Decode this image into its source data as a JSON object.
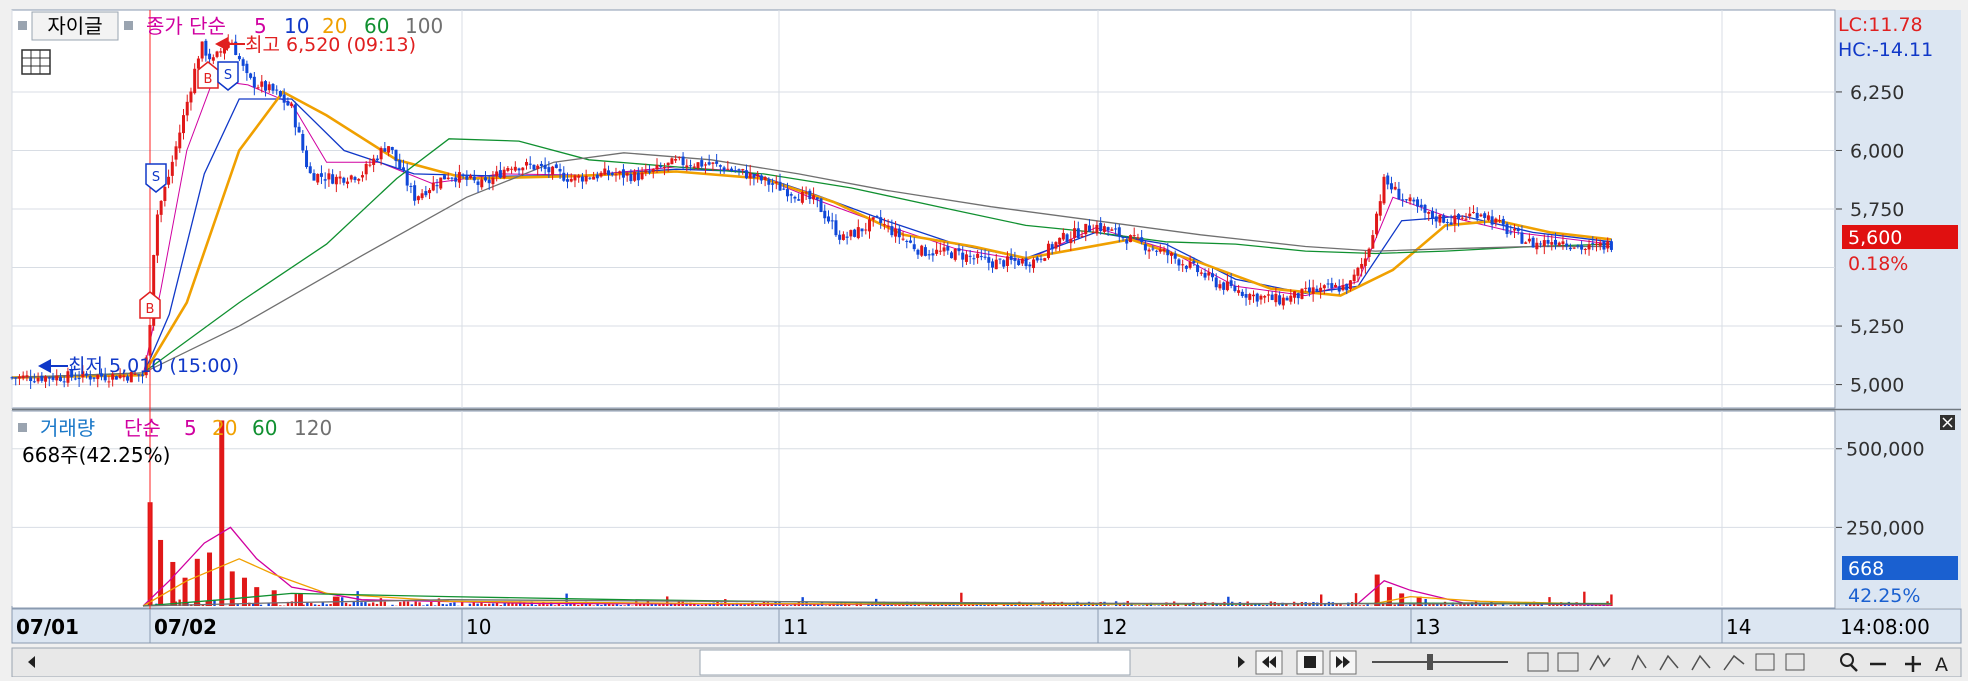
{
  "app": {
    "toolbar_button": "자이글",
    "icon_names": [
      "grid-icon",
      "close-icon",
      "rewind-icon",
      "stop-icon",
      "fast-forward-icon",
      "search-icon",
      "minus-icon",
      "plus-icon"
    ],
    "zoom_text_button": "A"
  },
  "price_panel": {
    "legend": {
      "label": "종가 단순",
      "periods": [
        "5",
        "10",
        "20",
        "60",
        "100"
      ],
      "colors": [
        "#d000a0",
        "#1038c8",
        "#f0a000",
        "#109030",
        "#707070"
      ]
    },
    "high_label": "최고 6,520 (09:13)",
    "low_label": "최저 5,010 (15:00)",
    "lc_label": "LC:11.78",
    "hc_label": "HC:-14.11",
    "current_price": "5,600",
    "change_pct": "0.18%",
    "axis_ticks": [
      "6,250",
      "6,000",
      "5,750",
      "5,250",
      "5,000"
    ],
    "signals": [
      "B",
      "S",
      "B",
      "S"
    ]
  },
  "volume_panel": {
    "legend": {
      "label": "거래량",
      "ma_label": "단순",
      "periods": [
        "5",
        "20",
        "60",
        "120"
      ],
      "colors": [
        "#d000a0",
        "#f0a000",
        "#109030",
        "#707070"
      ]
    },
    "info": "668주(42.25%)",
    "current_volume": "668",
    "current_pct": "42.25%",
    "axis_ticks": [
      "500,000",
      "250,000"
    ]
  },
  "x_axis": {
    "labels": [
      "07/01",
      "07/02",
      "10",
      "11",
      "12",
      "13",
      "14"
    ],
    "time": "14:08:00"
  },
  "chart_data": {
    "type": "candlestick",
    "price_range": [
      4900,
      6600
    ],
    "volume_range": [
      0,
      620000
    ],
    "session_dates": [
      "07/01",
      "07/02",
      "10",
      "11",
      "12",
      "13",
      "14"
    ],
    "price_path": [
      [
        0.0,
        5030
      ],
      [
        0.075,
        5040
      ],
      [
        0.078,
        5150
      ],
      [
        0.082,
        5700
      ],
      [
        0.09,
        5900
      ],
      [
        0.1,
        6200
      ],
      [
        0.108,
        6450
      ],
      [
        0.115,
        6380
      ],
      [
        0.125,
        6480
      ],
      [
        0.135,
        6300
      ],
      [
        0.15,
        6250
      ],
      [
        0.16,
        6180
      ],
      [
        0.17,
        5900
      ],
      [
        0.185,
        5880
      ],
      [
        0.2,
        5900
      ],
      [
        0.215,
        6030
      ],
      [
        0.23,
        5800
      ],
      [
        0.25,
        5900
      ],
      [
        0.27,
        5850
      ],
      [
        0.285,
        5940
      ],
      [
        0.3,
        5930
      ],
      [
        0.32,
        5880
      ],
      [
        0.34,
        5900
      ],
      [
        0.36,
        5890
      ],
      [
        0.38,
        5950
      ],
      [
        0.4,
        5940
      ],
      [
        0.42,
        5900
      ],
      [
        0.44,
        5840
      ],
      [
        0.46,
        5780
      ],
      [
        0.475,
        5620
      ],
      [
        0.495,
        5700
      ],
      [
        0.52,
        5570
      ],
      [
        0.54,
        5560
      ],
      [
        0.56,
        5520
      ],
      [
        0.585,
        5530
      ],
      [
        0.6,
        5620
      ],
      [
        0.62,
        5680
      ],
      [
        0.64,
        5620
      ],
      [
        0.66,
        5560
      ],
      [
        0.675,
        5500
      ],
      [
        0.69,
        5430
      ],
      [
        0.71,
        5380
      ],
      [
        0.725,
        5360
      ],
      [
        0.745,
        5400
      ],
      [
        0.765,
        5420
      ],
      [
        0.775,
        5550
      ],
      [
        0.785,
        5870
      ],
      [
        0.795,
        5800
      ],
      [
        0.81,
        5720
      ],
      [
        0.825,
        5700
      ],
      [
        0.84,
        5740
      ],
      [
        0.855,
        5660
      ],
      [
        0.87,
        5600
      ],
      [
        0.885,
        5620
      ],
      [
        0.9,
        5580
      ],
      [
        0.915,
        5600
      ]
    ],
    "ma_series": [
      {
        "name": "5",
        "values": [
          [
            0.0,
            5030
          ],
          [
            0.075,
            5040
          ],
          [
            0.085,
            5400
          ],
          [
            0.1,
            6000
          ],
          [
            0.115,
            6300
          ],
          [
            0.135,
            6280
          ],
          [
            0.16,
            6200
          ],
          [
            0.18,
            5950
          ],
          [
            0.21,
            5950
          ],
          [
            0.24,
            5860
          ],
          [
            0.28,
            5900
          ],
          [
            0.33,
            5895
          ],
          [
            0.38,
            5930
          ],
          [
            0.42,
            5910
          ],
          [
            0.46,
            5790
          ],
          [
            0.5,
            5680
          ],
          [
            0.54,
            5580
          ],
          [
            0.58,
            5530
          ],
          [
            0.62,
            5670
          ],
          [
            0.66,
            5580
          ],
          [
            0.7,
            5420
          ],
          [
            0.74,
            5380
          ],
          [
            0.77,
            5440
          ],
          [
            0.79,
            5800
          ],
          [
            0.82,
            5720
          ],
          [
            0.86,
            5650
          ],
          [
            0.915,
            5600
          ]
        ]
      },
      {
        "name": "10",
        "values": [
          [
            0.0,
            5030
          ],
          [
            0.075,
            5040
          ],
          [
            0.09,
            5300
          ],
          [
            0.11,
            5900
          ],
          [
            0.13,
            6220
          ],
          [
            0.16,
            6220
          ],
          [
            0.19,
            6000
          ],
          [
            0.23,
            5900
          ],
          [
            0.28,
            5890
          ],
          [
            0.33,
            5895
          ],
          [
            0.38,
            5920
          ],
          [
            0.42,
            5910
          ],
          [
            0.46,
            5810
          ],
          [
            0.5,
            5700
          ],
          [
            0.54,
            5600
          ],
          [
            0.58,
            5540
          ],
          [
            0.62,
            5650
          ],
          [
            0.66,
            5600
          ],
          [
            0.7,
            5450
          ],
          [
            0.74,
            5390
          ],
          [
            0.77,
            5420
          ],
          [
            0.795,
            5700
          ],
          [
            0.83,
            5720
          ],
          [
            0.87,
            5650
          ],
          [
            0.915,
            5610
          ]
        ]
      },
      {
        "name": "20",
        "values": [
          [
            0.0,
            5030
          ],
          [
            0.075,
            5040
          ],
          [
            0.1,
            5350
          ],
          [
            0.13,
            6000
          ],
          [
            0.155,
            6250
          ],
          [
            0.18,
            6150
          ],
          [
            0.22,
            5960
          ],
          [
            0.26,
            5880
          ],
          [
            0.32,
            5890
          ],
          [
            0.38,
            5910
          ],
          [
            0.43,
            5880
          ],
          [
            0.47,
            5780
          ],
          [
            0.51,
            5640
          ],
          [
            0.55,
            5590
          ],
          [
            0.58,
            5540
          ],
          [
            0.61,
            5580
          ],
          [
            0.64,
            5620
          ],
          [
            0.68,
            5520
          ],
          [
            0.72,
            5410
          ],
          [
            0.76,
            5380
          ],
          [
            0.79,
            5490
          ],
          [
            0.82,
            5680
          ],
          [
            0.85,
            5700
          ],
          [
            0.88,
            5650
          ],
          [
            0.915,
            5620
          ]
        ]
      },
      {
        "name": "60",
        "values": [
          [
            0.0,
            5030
          ],
          [
            0.075,
            5050
          ],
          [
            0.13,
            5350
          ],
          [
            0.18,
            5600
          ],
          [
            0.22,
            5880
          ],
          [
            0.25,
            6050
          ],
          [
            0.29,
            6040
          ],
          [
            0.33,
            5960
          ],
          [
            0.38,
            5930
          ],
          [
            0.43,
            5900
          ],
          [
            0.48,
            5840
          ],
          [
            0.53,
            5760
          ],
          [
            0.58,
            5680
          ],
          [
            0.62,
            5650
          ],
          [
            0.66,
            5610
          ],
          [
            0.7,
            5600
          ],
          [
            0.74,
            5570
          ],
          [
            0.78,
            5560
          ],
          [
            0.82,
            5570
          ],
          [
            0.87,
            5590
          ],
          [
            0.915,
            5600
          ]
        ]
      },
      {
        "name": "100",
        "values": [
          [
            0.0,
            5030
          ],
          [
            0.075,
            5050
          ],
          [
            0.13,
            5250
          ],
          [
            0.2,
            5550
          ],
          [
            0.26,
            5800
          ],
          [
            0.31,
            5950
          ],
          [
            0.35,
            5990
          ],
          [
            0.4,
            5960
          ],
          [
            0.45,
            5900
          ],
          [
            0.5,
            5830
          ],
          [
            0.56,
            5760
          ],
          [
            0.62,
            5700
          ],
          [
            0.68,
            5640
          ],
          [
            0.74,
            5590
          ],
          [
            0.78,
            5570
          ],
          [
            0.82,
            5580
          ],
          [
            0.87,
            5590
          ],
          [
            0.915,
            5590
          ]
        ]
      }
    ],
    "volume_ma_series": [
      {
        "name": "5",
        "values": [
          [
            0.075,
            0
          ],
          [
            0.09,
            80000
          ],
          [
            0.11,
            200000
          ],
          [
            0.125,
            250000
          ],
          [
            0.14,
            150000
          ],
          [
            0.16,
            60000
          ],
          [
            0.2,
            20000
          ],
          [
            0.3,
            8000
          ],
          [
            0.5,
            5000
          ],
          [
            0.77,
            8000
          ],
          [
            0.785,
            80000
          ],
          [
            0.8,
            50000
          ],
          [
            0.83,
            10000
          ],
          [
            0.915,
            3000
          ]
        ]
      },
      {
        "name": "20",
        "values": [
          [
            0.075,
            0
          ],
          [
            0.1,
            80000
          ],
          [
            0.13,
            150000
          ],
          [
            0.15,
            100000
          ],
          [
            0.18,
            40000
          ],
          [
            0.25,
            15000
          ],
          [
            0.4,
            8000
          ],
          [
            0.6,
            5000
          ],
          [
            0.78,
            8000
          ],
          [
            0.8,
            30000
          ],
          [
            0.84,
            15000
          ],
          [
            0.915,
            5000
          ]
        ]
      },
      {
        "name": "60",
        "values": [
          [
            0.075,
            0
          ],
          [
            0.12,
            20000
          ],
          [
            0.16,
            40000
          ],
          [
            0.25,
            30000
          ],
          [
            0.35,
            20000
          ],
          [
            0.5,
            10000
          ],
          [
            0.7,
            6000
          ],
          [
            0.8,
            9000
          ],
          [
            0.915,
            8000
          ]
        ]
      },
      {
        "name": "120",
        "values": [
          [
            0.075,
            0
          ],
          [
            0.15,
            10000
          ],
          [
            0.25,
            20000
          ],
          [
            0.4,
            15000
          ],
          [
            0.6,
            9000
          ],
          [
            0.8,
            7000
          ],
          [
            0.915,
            6000
          ]
        ]
      }
    ],
    "volume_bars": [
      [
        0.079,
        330000
      ],
      [
        0.085,
        210000
      ],
      [
        0.092,
        140000
      ],
      [
        0.099,
        90000
      ],
      [
        0.106,
        150000
      ],
      [
        0.113,
        170000
      ],
      [
        0.12,
        590000
      ],
      [
        0.126,
        110000
      ],
      [
        0.133,
        90000
      ],
      [
        0.14,
        60000
      ],
      [
        0.15,
        50000
      ],
      [
        0.165,
        40000
      ],
      [
        0.185,
        30000
      ],
      [
        0.781,
        100000
      ],
      [
        0.788,
        60000
      ],
      [
        0.795,
        40000
      ],
      [
        0.805,
        30000
      ]
    ],
    "volume_noise_max": 30000
  }
}
